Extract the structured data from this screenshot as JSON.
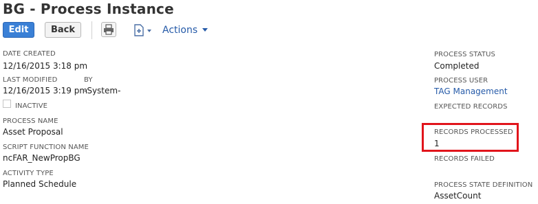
{
  "header": {
    "title": "BG - Process Instance"
  },
  "toolbar": {
    "edit_label": "Edit",
    "back_label": "Back",
    "actions_label": "Actions",
    "print_icon": "printer-icon",
    "new_icon": "new-record-icon"
  },
  "fields_left": {
    "date_created": {
      "label": "DATE CREATED",
      "value": "12/16/2015 3:18 pm"
    },
    "last_modified": {
      "label": "LAST MODIFIED",
      "value": "12/16/2015 3:19 pm"
    },
    "by": {
      "label": "BY",
      "value": "-System-"
    },
    "inactive": {
      "label": "INACTIVE",
      "checked": false
    },
    "process_name": {
      "label": "PROCESS NAME",
      "value": "Asset Proposal"
    },
    "script_function_name": {
      "label": "SCRIPT FUNCTION NAME",
      "value": "ncFAR_NewPropBG"
    },
    "activity_type": {
      "label": "ACTIVITY TYPE",
      "value": "Planned Schedule"
    }
  },
  "fields_right": {
    "process_status": {
      "label": "PROCESS STATUS",
      "value": "Completed"
    },
    "process_user": {
      "label": "PROCESS USER",
      "value": "TAG Management"
    },
    "expected_records": {
      "label": "EXPECTED RECORDS",
      "value": ""
    },
    "records_processed": {
      "label": "RECORDS PROCESSED",
      "value": "1"
    },
    "records_failed": {
      "label": "RECORDS FAILED",
      "value": ""
    },
    "process_state_definition": {
      "label": "PROCESS STATE DEFINITION",
      "value": "AssetCount"
    }
  },
  "colors": {
    "edit_button": "#3a80d6",
    "link": "#255aa8",
    "highlight": "#e1141b"
  }
}
